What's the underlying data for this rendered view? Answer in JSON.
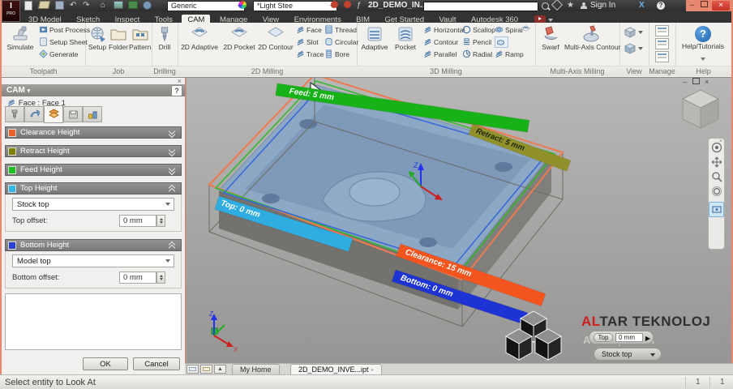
{
  "titlebar": {
    "app_title": "2D_DEMO_IN...",
    "material": "Generic",
    "appearance": "*Light Stee",
    "sign_in": "Sign In"
  },
  "glyphs": {
    "caret_down": "▾",
    "undo": "↶",
    "redo": "↷",
    "home": "⌂",
    "star": "★",
    "fx": "ƒ",
    "question": "?",
    "exchange": "X",
    "minimize": "–",
    "close": "×",
    "up_arrow": "▲",
    "play": "▶"
  },
  "tabs": {
    "items": [
      "3D Model",
      "Sketch",
      "Inspect",
      "Tools",
      "CAM",
      "Manage",
      "View",
      "Environments",
      "BIM",
      "Get Started",
      "Vault",
      "Autodesk 360"
    ]
  },
  "ribbon": {
    "toolpath": {
      "label": "Toolpath",
      "simulate": "Simulate",
      "items": [
        "Post Process",
        "Setup Sheet",
        "Generate"
      ]
    },
    "job": {
      "label": "Job",
      "items": [
        "Setup",
        "Folder",
        "Pattern"
      ]
    },
    "drilling": {
      "label": "Drilling",
      "drill": "Drill"
    },
    "m2d": {
      "label": "2D Milling",
      "big": [
        "2D Adaptive",
        "2D Pocket",
        "2D Contour"
      ],
      "col1": [
        "Face",
        "Slot",
        "Trace"
      ],
      "col2": [
        "Thread",
        "Circular",
        "Bore"
      ]
    },
    "m3d": {
      "label": "3D Milling",
      "big": [
        "Adaptive",
        "Pocket"
      ],
      "col1": [
        "Horizontal",
        "Contour",
        "Parallel"
      ],
      "col2": [
        "Scallop",
        "Pencil",
        "Radial"
      ],
      "col3": [
        "Spiral",
        "Ramp"
      ]
    },
    "multiaxis": {
      "label": "Multi-Axis Milling",
      "items": [
        "Swarf",
        "Multi-Axis Contour"
      ]
    },
    "view": {
      "label": "View"
    },
    "manage": {
      "label": "Manage"
    },
    "help": {
      "label": "Help",
      "button": "Help/Tutorials"
    }
  },
  "panel": {
    "title": "CAM",
    "operation": "Face : Face 1",
    "sections": {
      "clearance": {
        "label": "Clearance Height",
        "color": "#e8622d"
      },
      "retract": {
        "label": "Retract Height",
        "color": "#7f7f00"
      },
      "feed": {
        "label": "Feed Height",
        "color": "#1fbf1f"
      },
      "top": {
        "label": "Top Height",
        "color": "#35b5e5",
        "select": "Stock top",
        "offset_label": "Top offset:",
        "offset_value": "0 mm"
      },
      "bottom": {
        "label": "Bottom Height",
        "color": "#2a3fd4",
        "select": "Model top",
        "offset_label": "Bottom offset:",
        "offset_value": "0 mm"
      }
    },
    "ok": "OK",
    "cancel": "Cancel"
  },
  "viewport": {
    "planes": {
      "feed": {
        "text": "Feed: 5 mm",
        "color": "#17b217"
      },
      "retract": {
        "text": "Retract: 5 mm",
        "color": "#91912c"
      },
      "top": {
        "text": "Top: 0 mm",
        "color": "#2fade0"
      },
      "clearance": {
        "text": "Clearance: 15 mm",
        "color": "#f4541d"
      },
      "bottom": {
        "text": "Bottom: 0 mm",
        "color": "#1d33d4"
      }
    },
    "axes": {
      "x": "X",
      "z": "Z"
    }
  },
  "branding": {
    "brand_red": "AL",
    "brand_rest": "TAR TEKNOLOJ",
    "brand_red_color": "#cc1f1f",
    "watermark": "A M | C A",
    "mini_top_label": "Top",
    "mini_top_value": "0 mm",
    "mini_stock": "Stock top"
  },
  "docbar": {
    "tabs": [
      "My Home",
      "2D_DEMO_INVE...ipt"
    ]
  },
  "statusbar": {
    "message": "Select entity to Look At",
    "counters": [
      "1",
      "1"
    ]
  }
}
